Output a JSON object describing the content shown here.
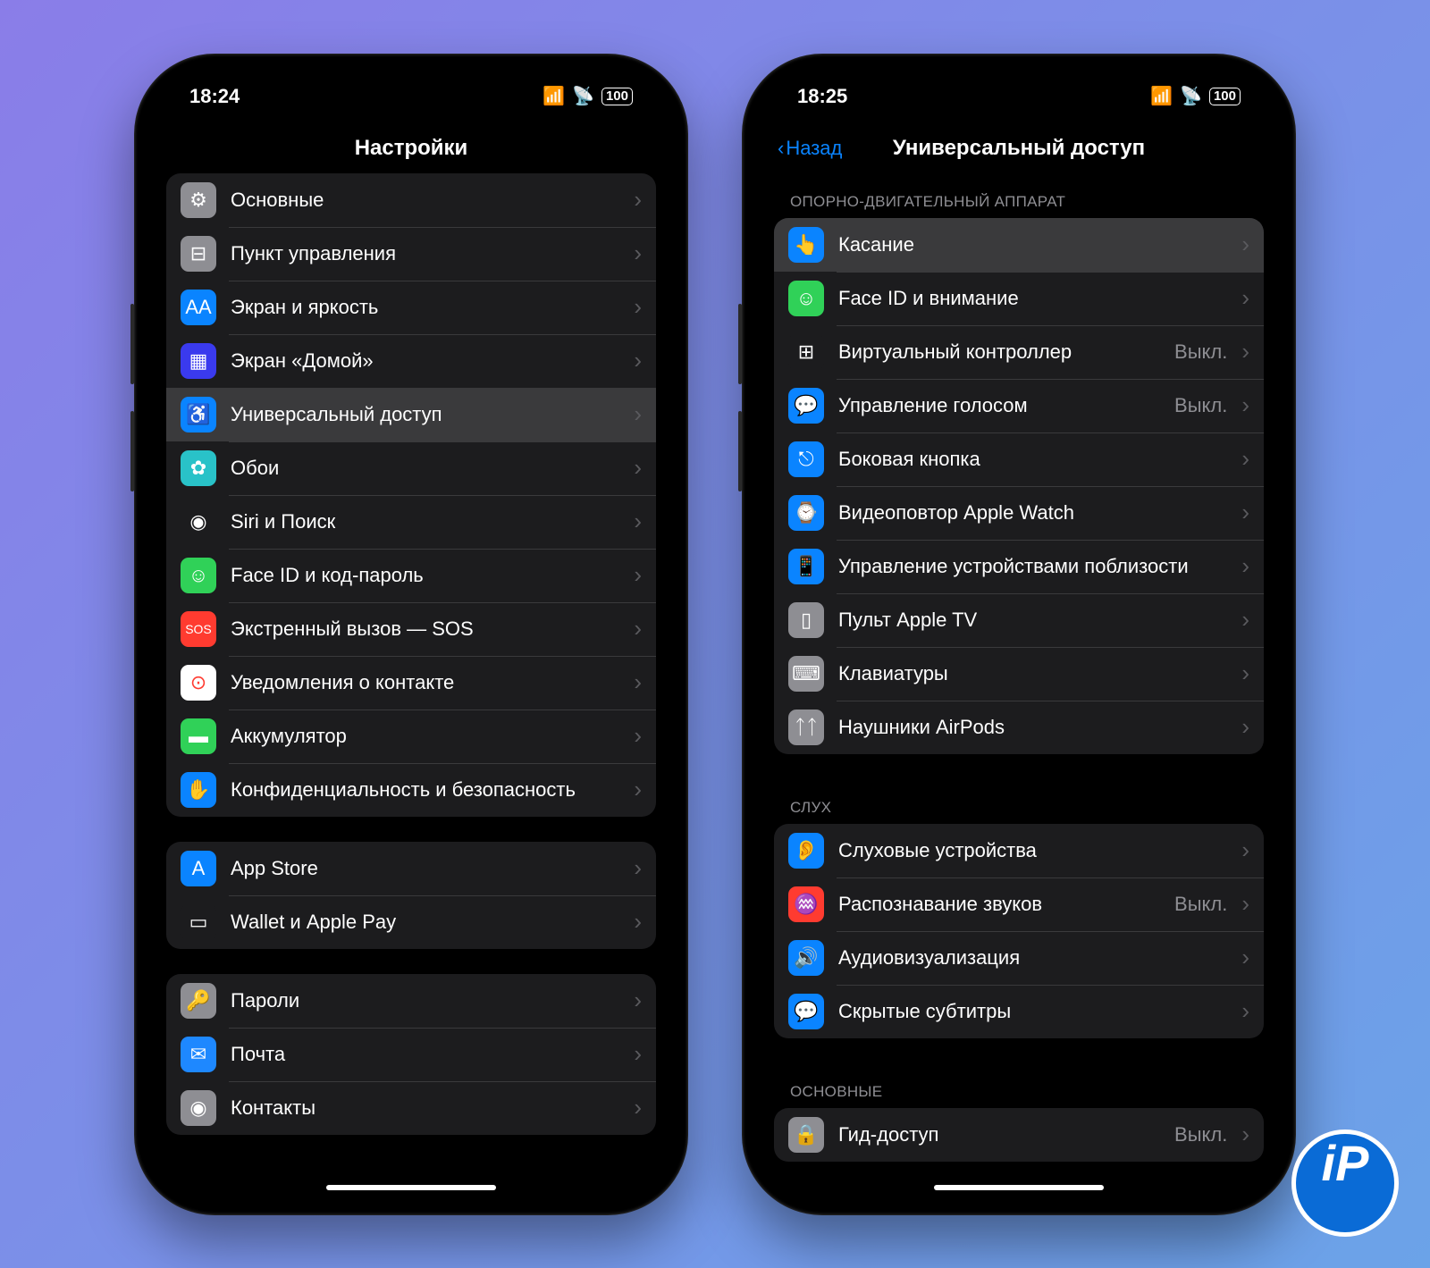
{
  "logo_text": "iP",
  "left": {
    "time": "18:24",
    "battery": "100",
    "title": "Настройки",
    "groups": [
      {
        "rows": [
          {
            "name": "general",
            "label": "Основные",
            "icon_bg": "#8e8e93",
            "glyph": "⚙"
          },
          {
            "name": "control-center",
            "label": "Пункт управления",
            "icon_bg": "#8e8e93",
            "glyph": "⊟"
          },
          {
            "name": "display",
            "label": "Экран и яркость",
            "icon_bg": "#0a84ff",
            "glyph": "AA"
          },
          {
            "name": "home-screen",
            "label": "Экран «Домой»",
            "icon_bg": "#3a3aee",
            "glyph": "▦"
          },
          {
            "name": "accessibility",
            "label": "Универсальный доступ",
            "icon_bg": "#0a84ff",
            "glyph": "♿",
            "selected": true
          },
          {
            "name": "wallpaper",
            "label": "Обои",
            "icon_bg": "#29c2c8",
            "glyph": "✿"
          },
          {
            "name": "siri",
            "label": "Siri и Поиск",
            "icon_bg": "#1c1c1e",
            "glyph": "◉"
          },
          {
            "name": "faceid",
            "label": "Face ID и код-пароль",
            "icon_bg": "#30d158",
            "glyph": "☺"
          },
          {
            "name": "sos",
            "label": "Экстренный вызов — SOS",
            "icon_bg": "#ff3b30",
            "glyph": "SOS"
          },
          {
            "name": "exposure",
            "label": "Уведомления о контакте",
            "icon_bg": "#fff",
            "glyph": "⊙",
            "fg": "#ff3b30"
          },
          {
            "name": "battery",
            "label": "Аккумулятор",
            "icon_bg": "#30d158",
            "glyph": "▬"
          },
          {
            "name": "privacy",
            "label": "Конфиденциальность и безопасность",
            "icon_bg": "#0a84ff",
            "glyph": "✋"
          }
        ]
      },
      {
        "rows": [
          {
            "name": "appstore",
            "label": "App Store",
            "icon_bg": "#0a84ff",
            "glyph": "A"
          },
          {
            "name": "wallet",
            "label": "Wallet и Apple Pay",
            "icon_bg": "#1c1c1e",
            "glyph": "▭"
          }
        ]
      },
      {
        "rows": [
          {
            "name": "passwords",
            "label": "Пароли",
            "icon_bg": "#8e8e93",
            "glyph": "🔑"
          },
          {
            "name": "mail",
            "label": "Почта",
            "icon_bg": "#1e88ff",
            "glyph": "✉"
          },
          {
            "name": "contacts",
            "label": "Контакты",
            "icon_bg": "#8e8e93",
            "glyph": "◉"
          }
        ]
      }
    ]
  },
  "right": {
    "time": "18:25",
    "battery": "100",
    "back": "Назад",
    "title": "Универсальный доступ",
    "sections": [
      {
        "header": "Опорно-двигательный аппарат",
        "rows": [
          {
            "name": "touch",
            "label": "Касание",
            "icon_bg": "#0a84ff",
            "glyph": "👆",
            "selected": true
          },
          {
            "name": "faceid-attention",
            "label": "Face ID и внимание",
            "icon_bg": "#30d158",
            "glyph": "☺"
          },
          {
            "name": "switch-control",
            "label": "Виртуальный контроллер",
            "icon_bg": "#1c1c1e",
            "glyph": "⊞",
            "detail": "Выкл."
          },
          {
            "name": "voice-control",
            "label": "Управление голосом",
            "icon_bg": "#0a84ff",
            "glyph": "💬",
            "detail": "Выкл."
          },
          {
            "name": "side-button",
            "label": "Боковая кнопка",
            "icon_bg": "#0a84ff",
            "glyph": "⎋"
          },
          {
            "name": "watch-mirror",
            "label": "Видеоповтор Apple Watch",
            "icon_bg": "#0a84ff",
            "glyph": "⌚"
          },
          {
            "name": "nearby-control",
            "label": "Управление устройствами поблизости",
            "icon_bg": "#0a84ff",
            "glyph": "📱"
          },
          {
            "name": "apple-tv-remote",
            "label": "Пульт Apple TV",
            "icon_bg": "#8e8e93",
            "glyph": "▯"
          },
          {
            "name": "keyboards",
            "label": "Клавиатуры",
            "icon_bg": "#8e8e93",
            "glyph": "⌨"
          },
          {
            "name": "airpods",
            "label": "Наушники AirPods",
            "icon_bg": "#8e8e93",
            "glyph": "ᛏᛏ"
          }
        ]
      },
      {
        "header": "Слух",
        "rows": [
          {
            "name": "hearing-devices",
            "label": "Слуховые устройства",
            "icon_bg": "#0a84ff",
            "glyph": "👂"
          },
          {
            "name": "sound-recognition",
            "label": "Распознавание звуков",
            "icon_bg": "#ff3b30",
            "glyph": "♒",
            "detail": "Выкл."
          },
          {
            "name": "audio-visual",
            "label": "Аудиовизуализация",
            "icon_bg": "#0a84ff",
            "glyph": "🔊"
          },
          {
            "name": "subtitles",
            "label": "Скрытые субтитры",
            "icon_bg": "#0a84ff",
            "glyph": "💬"
          }
        ]
      },
      {
        "header": "Основные",
        "rows": [
          {
            "name": "guided-access",
            "label": "Гид-доступ",
            "icon_bg": "#8e8e93",
            "glyph": "🔒",
            "detail": "Выкл."
          }
        ]
      }
    ]
  }
}
